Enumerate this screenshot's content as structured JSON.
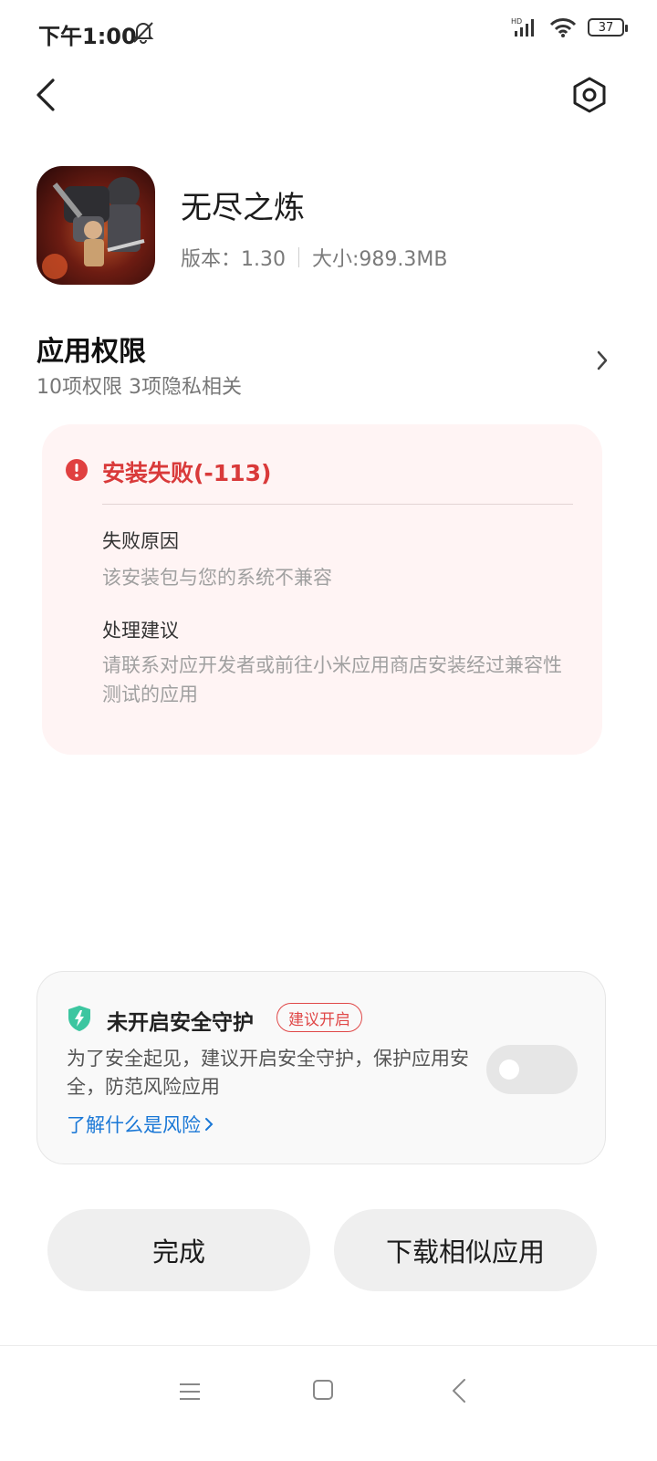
{
  "status_bar": {
    "time": "下午1:00",
    "network_label": "HD",
    "battery": "37"
  },
  "header": {
    "back_icon": "back-arrow-icon",
    "settings_icon": "settings-hexagon-icon"
  },
  "app": {
    "name": "无尽之炼",
    "version_text": "版本：1.30",
    "size_text": "大小:989.3MB"
  },
  "permissions": {
    "title": "应用权限",
    "subtitle": "10项权限 3项隐私相关"
  },
  "error": {
    "title": "安装失败(-113)",
    "reason_label": "失败原因",
    "reason_text": "该安装包与您的系统不兼容",
    "advice_label": "处理建议",
    "advice_text": "请联系对应开发者或前往小米应用商店安装经过兼容性测试的应用",
    "color": "#d93a3a"
  },
  "security": {
    "title": "未开启安全守护",
    "badge": "建议开启",
    "description": "为了安全起见，建议开启安全守护，保护应用安全，防范风险应用",
    "link": "了解什么是风险",
    "toggle_on": false,
    "link_color": "#1977d6"
  },
  "buttons": {
    "done": "完成",
    "download_similar": "下载相似应用"
  }
}
